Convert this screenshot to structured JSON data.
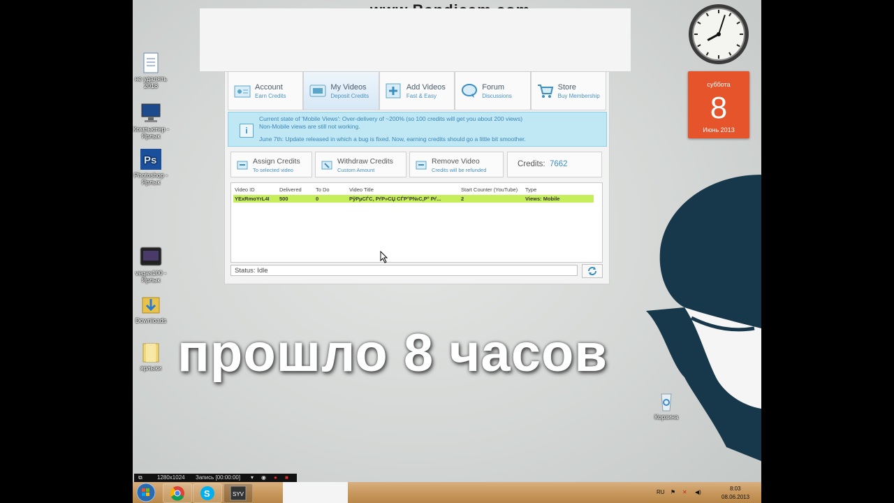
{
  "watermark": "www.Bandicam.com",
  "desktop_icons": [
    {
      "label": "не удалять 2018",
      "icon": "document-icon"
    },
    {
      "label": "Компьютер - Ярлык",
      "icon": "computer-icon"
    },
    {
      "label": "Photoshop - Ярлык",
      "icon": "photoshop-icon"
    },
    {
      "label": "vegas100 - Ярлык",
      "icon": "vegas-icon"
    },
    {
      "label": "Downloads",
      "icon": "downloads-folder-icon"
    },
    {
      "label": "ярлыки",
      "icon": "folder-icon"
    },
    {
      "label": "Корзина",
      "icon": "recycle-bin-icon"
    }
  ],
  "tabs": [
    {
      "title": "Account",
      "subtitle": "Earn Credits"
    },
    {
      "title": "My Videos",
      "subtitle": "Deposit Credits"
    },
    {
      "title": "Add Videos",
      "subtitle": "Fast & Easy"
    },
    {
      "title": "Forum",
      "subtitle": "Discussions"
    },
    {
      "title": "Store",
      "subtitle": "Buy Membership"
    }
  ],
  "notice": {
    "line1": "Current state of 'Mobile Views': Over-delivery of ~200% (so 100 credits will get you about 200 views)",
    "line2": "Non-Mobile views are still not working.",
    "line3": "June 7th: Update released in which a bug is fixed. Now, earning credits should go a little bit smoother."
  },
  "actions": {
    "assign": {
      "title": "Assign Credits",
      "subtitle": "To selected video"
    },
    "withdraw": {
      "title": "Withdraw Credits",
      "subtitle": "Custom Amount"
    },
    "remove": {
      "title": "Remove Video",
      "subtitle": "Credits will be refunded"
    }
  },
  "credits": {
    "label": "Credits:",
    "value": "7662"
  },
  "table": {
    "headers": [
      "Video ID",
      "Delivered",
      "To Do",
      "Video Title",
      "Start Counter (YouTube)",
      "Type"
    ],
    "rows": [
      [
        "YExRmoYrL4I",
        "500",
        "0",
        "РўРµСЃС‚ РґР»СЏ СЃР°Р№С‚Р° Рґ...",
        "2",
        "Views: Mobile"
      ]
    ]
  },
  "status": "Status: Idle",
  "overlay_text": "прошло 8 часов",
  "calendar": {
    "weekday": "суббота",
    "day": "8",
    "month_year": "Июнь 2013"
  },
  "clock": {
    "hour": 8,
    "minute": 3
  },
  "recording": {
    "resolution": "1280x1024",
    "label": "Запись [00:00:00]"
  },
  "tray": {
    "lang": "RU",
    "time": "8:03",
    "date": "08.06.2013"
  },
  "colors": {
    "accent": "#3a8ec0",
    "row_highlight": "#c6ee5a",
    "calendar": "#e5542a"
  }
}
